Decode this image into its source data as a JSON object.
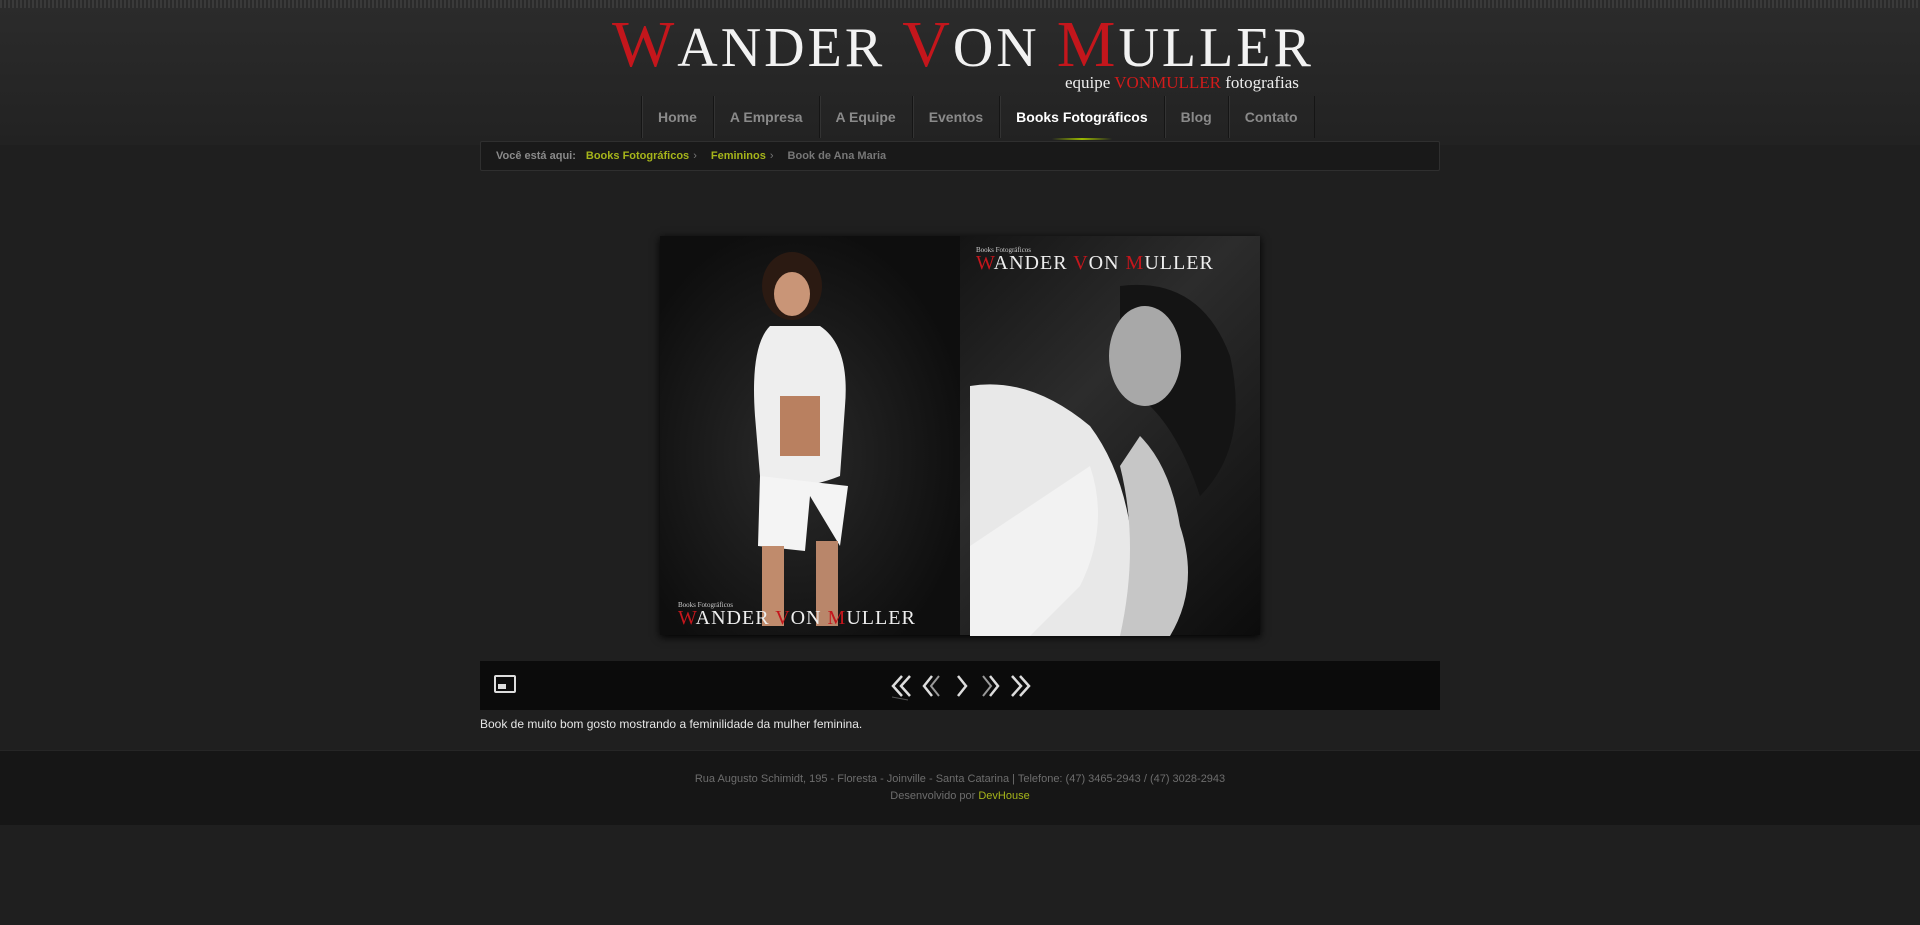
{
  "header": {
    "logo": {
      "parts": [
        {
          "cap": "W",
          "rest": "ANDER "
        },
        {
          "cap": "V",
          "rest": "ON "
        },
        {
          "cap": "M",
          "rest": "ULLER"
        }
      ]
    },
    "tagline": {
      "pre": "equipe ",
      "brand": "VONMULLER",
      "post": " fotografias"
    }
  },
  "nav": {
    "items": [
      {
        "label": "Home"
      },
      {
        "label": "A Empresa"
      },
      {
        "label": "A Equipe"
      },
      {
        "label": "Eventos"
      },
      {
        "label": "Books Fotográficos",
        "active": true
      },
      {
        "label": "Blog"
      },
      {
        "label": "Contato"
      }
    ]
  },
  "breadcrumb": {
    "label": "Você está aqui:",
    "links": [
      "Books Fotográficos",
      "Femininos"
    ],
    "separator": "›",
    "current": "Book de Ana Maria"
  },
  "photo": {
    "watermark_small": "Books Fotográficos",
    "watermark": [
      {
        "cap": "W",
        "rest": "ANDER "
      },
      {
        "cap": "V",
        "rest": "ON "
      },
      {
        "cap": "M",
        "rest": "ULLER"
      }
    ]
  },
  "controls": {
    "icons": [
      "thumbnails-toggle-icon",
      "first-icon",
      "previous-icon",
      "play-icon",
      "next-icon",
      "last-icon"
    ]
  },
  "caption": "Book de muito bom gosto mostrando a feminilidade da mulher feminina.",
  "footer": {
    "address": "Rua Augusto Schimidt, 195 - Floresta - Joinville - Santa Catarina | Telefone: (47) 3465-2943 / (47) 3028-2943",
    "dev_prefix": "Desenvolvido por ",
    "dev_link": "DevHouse"
  },
  "colors": {
    "accent_red": "#c4161c",
    "link_green": "#a6b51a",
    "background": "#1f1f1f"
  }
}
